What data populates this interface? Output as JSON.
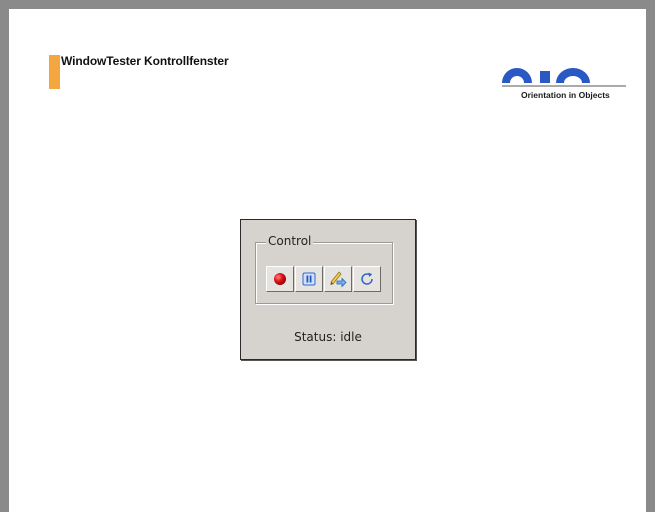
{
  "slide": {
    "title": "WindowTester Kontrollfenster"
  },
  "logo": {
    "tagline": "Orientation in Objects",
    "brand_color": "#2b59c3"
  },
  "dialog": {
    "group_label": "Control",
    "buttons": [
      {
        "icon": "record-icon",
        "label": "Record"
      },
      {
        "icon": "pause-icon",
        "label": "Pause"
      },
      {
        "icon": "write-code-icon",
        "label": "Write"
      },
      {
        "icon": "restart-icon",
        "label": "Restart"
      }
    ],
    "status_text": "Status: idle"
  },
  "colors": {
    "accent": "#f4a640",
    "frame": "#8a8a8a",
    "dialog_bg": "#d6d3ce"
  }
}
